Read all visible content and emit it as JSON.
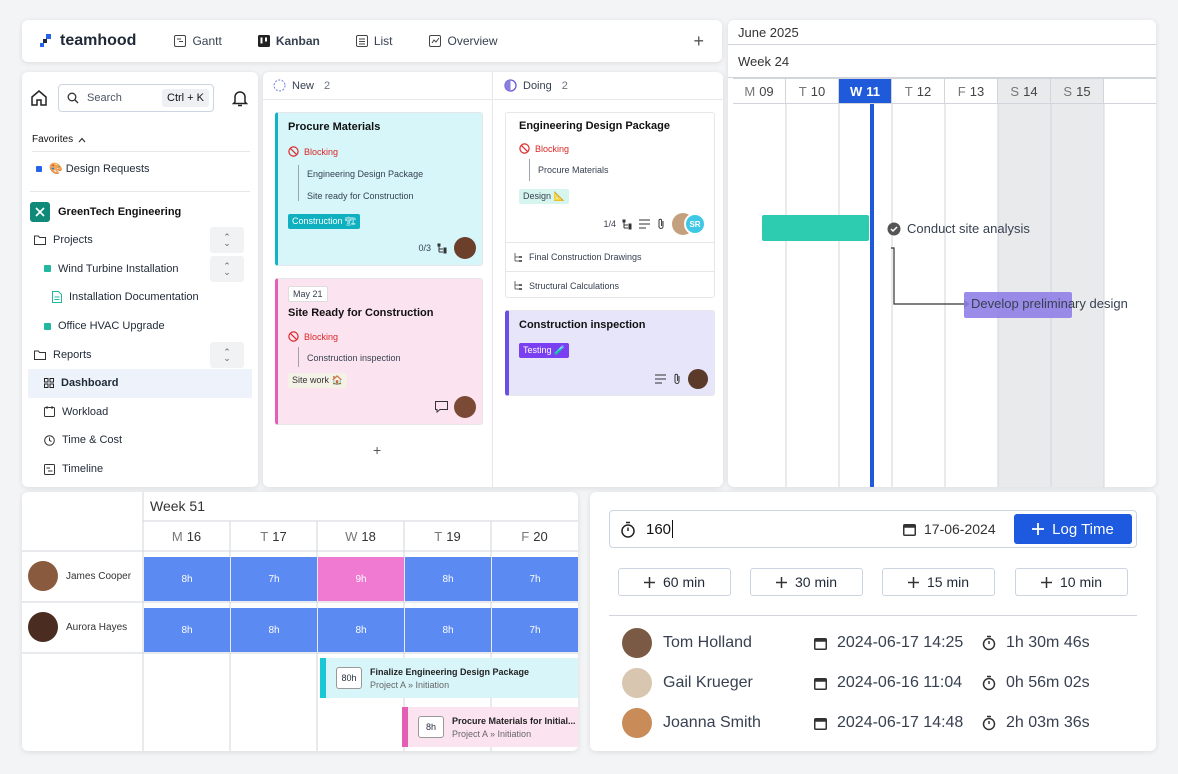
{
  "nav": {
    "logo": "teamhood",
    "tabs": [
      {
        "label": "Gantt"
      },
      {
        "label": "Kanban"
      },
      {
        "label": "List"
      },
      {
        "label": "Overview"
      }
    ],
    "add": "+"
  },
  "sidebar": {
    "search_placeholder": "Search",
    "shortcut": "Ctrl + K",
    "favorites_label": "Favorites",
    "favorite_item": "🎨 Design Requests",
    "workspace": "GreenTech Engineering",
    "items": [
      {
        "label": "Projects"
      },
      {
        "label": "Wind Turbine Installation"
      },
      {
        "label": "Installation Documentation"
      },
      {
        "label": "Office HVAC Upgrade"
      },
      {
        "label": "Reports"
      },
      {
        "label": "Dashboard"
      },
      {
        "label": "Workload"
      },
      {
        "label": "Time & Cost"
      },
      {
        "label": "Timeline"
      }
    ]
  },
  "kanban": {
    "columns": [
      {
        "name": "New",
        "count": "2"
      },
      {
        "name": "Doing",
        "count": "2"
      }
    ],
    "add": "+",
    "cards": {
      "c1": {
        "title": "Procure Materials",
        "blocking": "Blocking",
        "sub1": "Engineering Design Package",
        "sub2": "Site ready for Construction",
        "tag": "Construction 🏗",
        "count": "0/3"
      },
      "c2": {
        "date": "May 21",
        "title": "Site Ready for Construction",
        "blocking": "Blocking",
        "sub1": "Construction inspection",
        "tag": "Site work 🏠"
      },
      "c3": {
        "title": "Engineering Design Package",
        "blocking": "Blocking",
        "sub1": "Procure Materials",
        "tag": "Design 📐",
        "count": "1/4",
        "initials": "SR",
        "child1": "Final Construction Drawings",
        "child2": "Structural Calculations"
      },
      "c4": {
        "title": "Construction inspection",
        "tag": "Testing 🧪"
      }
    }
  },
  "gantt": {
    "month": "June 2025",
    "week": "Week 24",
    "days": [
      {
        "d": "M",
        "n": "09"
      },
      {
        "d": "T",
        "n": "10"
      },
      {
        "d": "W",
        "n": "11"
      },
      {
        "d": "T",
        "n": "12"
      },
      {
        "d": "F",
        "n": "13"
      },
      {
        "d": "S",
        "n": "14"
      },
      {
        "d": "S",
        "n": "15"
      }
    ],
    "task1": "Conduct site analysis",
    "task2": "Develop preliminary design"
  },
  "schedule": {
    "week": "Week 51",
    "days": [
      {
        "d": "M",
        "n": "16"
      },
      {
        "d": "T",
        "n": "17"
      },
      {
        "d": "W",
        "n": "18"
      },
      {
        "d": "T",
        "n": "19"
      },
      {
        "d": "F",
        "n": "20"
      }
    ],
    "people": [
      {
        "name": "James Cooper",
        "hours": [
          "8h",
          "7h",
          "9h",
          "8h",
          "7h"
        ]
      },
      {
        "name": "Aurora Hayes",
        "hours": [
          "8h",
          "8h",
          "8h",
          "8h",
          "7h"
        ]
      }
    ],
    "tasks": [
      {
        "hours": "80h",
        "title": "Finalize Engineering Design Package",
        "project": "Project A",
        "phase": "Initiation"
      },
      {
        "hours": "8h",
        "title": "Procure Materials for Initial...",
        "project": "Project A",
        "phase": "Initiation"
      }
    ],
    "colors": {
      "blue": "#5a8af2",
      "pink": "#f07ad2"
    }
  },
  "timelog": {
    "value": "160",
    "date": "17-06-2024",
    "log_button": "Log Time",
    "quick": [
      "60 min",
      "30 min",
      "15 min",
      "10 min"
    ],
    "entries": [
      {
        "name": "Tom Holland",
        "datetime": "2024-06-17 14:25",
        "duration": "1h 30m 46s"
      },
      {
        "name": "Gail Krueger",
        "datetime": "2024-06-16 11:04",
        "duration": "0h 56m 02s"
      },
      {
        "name": "Joanna Smith",
        "datetime": "2024-06-17 14:48",
        "duration": "2h 03m 36s"
      }
    ]
  }
}
